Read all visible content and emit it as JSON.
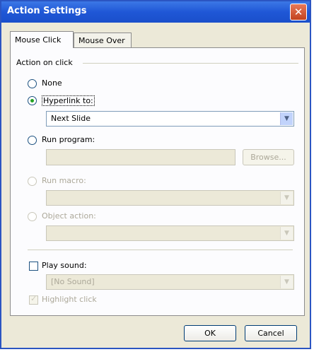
{
  "window": {
    "title": "Action Settings",
    "close_glyph": "✕"
  },
  "tabs": [
    {
      "label": "Mouse Click",
      "active": true
    },
    {
      "label": "Mouse Over",
      "active": false
    }
  ],
  "group": {
    "label": "Action on click"
  },
  "options": {
    "none": "None",
    "hyperlink": "Hyperlink to:",
    "hyperlink_value": "Next Slide",
    "run_program": "Run program:",
    "run_program_value": "",
    "browse_label": "Browse...",
    "run_macro": "Run macro:",
    "object_action": "Object action:"
  },
  "sound": {
    "label": "Play sound:",
    "value": "[No Sound]",
    "highlight_label": "Highlight click"
  },
  "buttons": {
    "ok": "OK",
    "cancel": "Cancel"
  },
  "icons": {
    "dropdown": "chevron-down-icon",
    "close": "close-icon"
  },
  "colors": {
    "titlebar": "#1f57d6",
    "dialog_bg": "#ece9d8",
    "radio_checked": "#21a121"
  }
}
